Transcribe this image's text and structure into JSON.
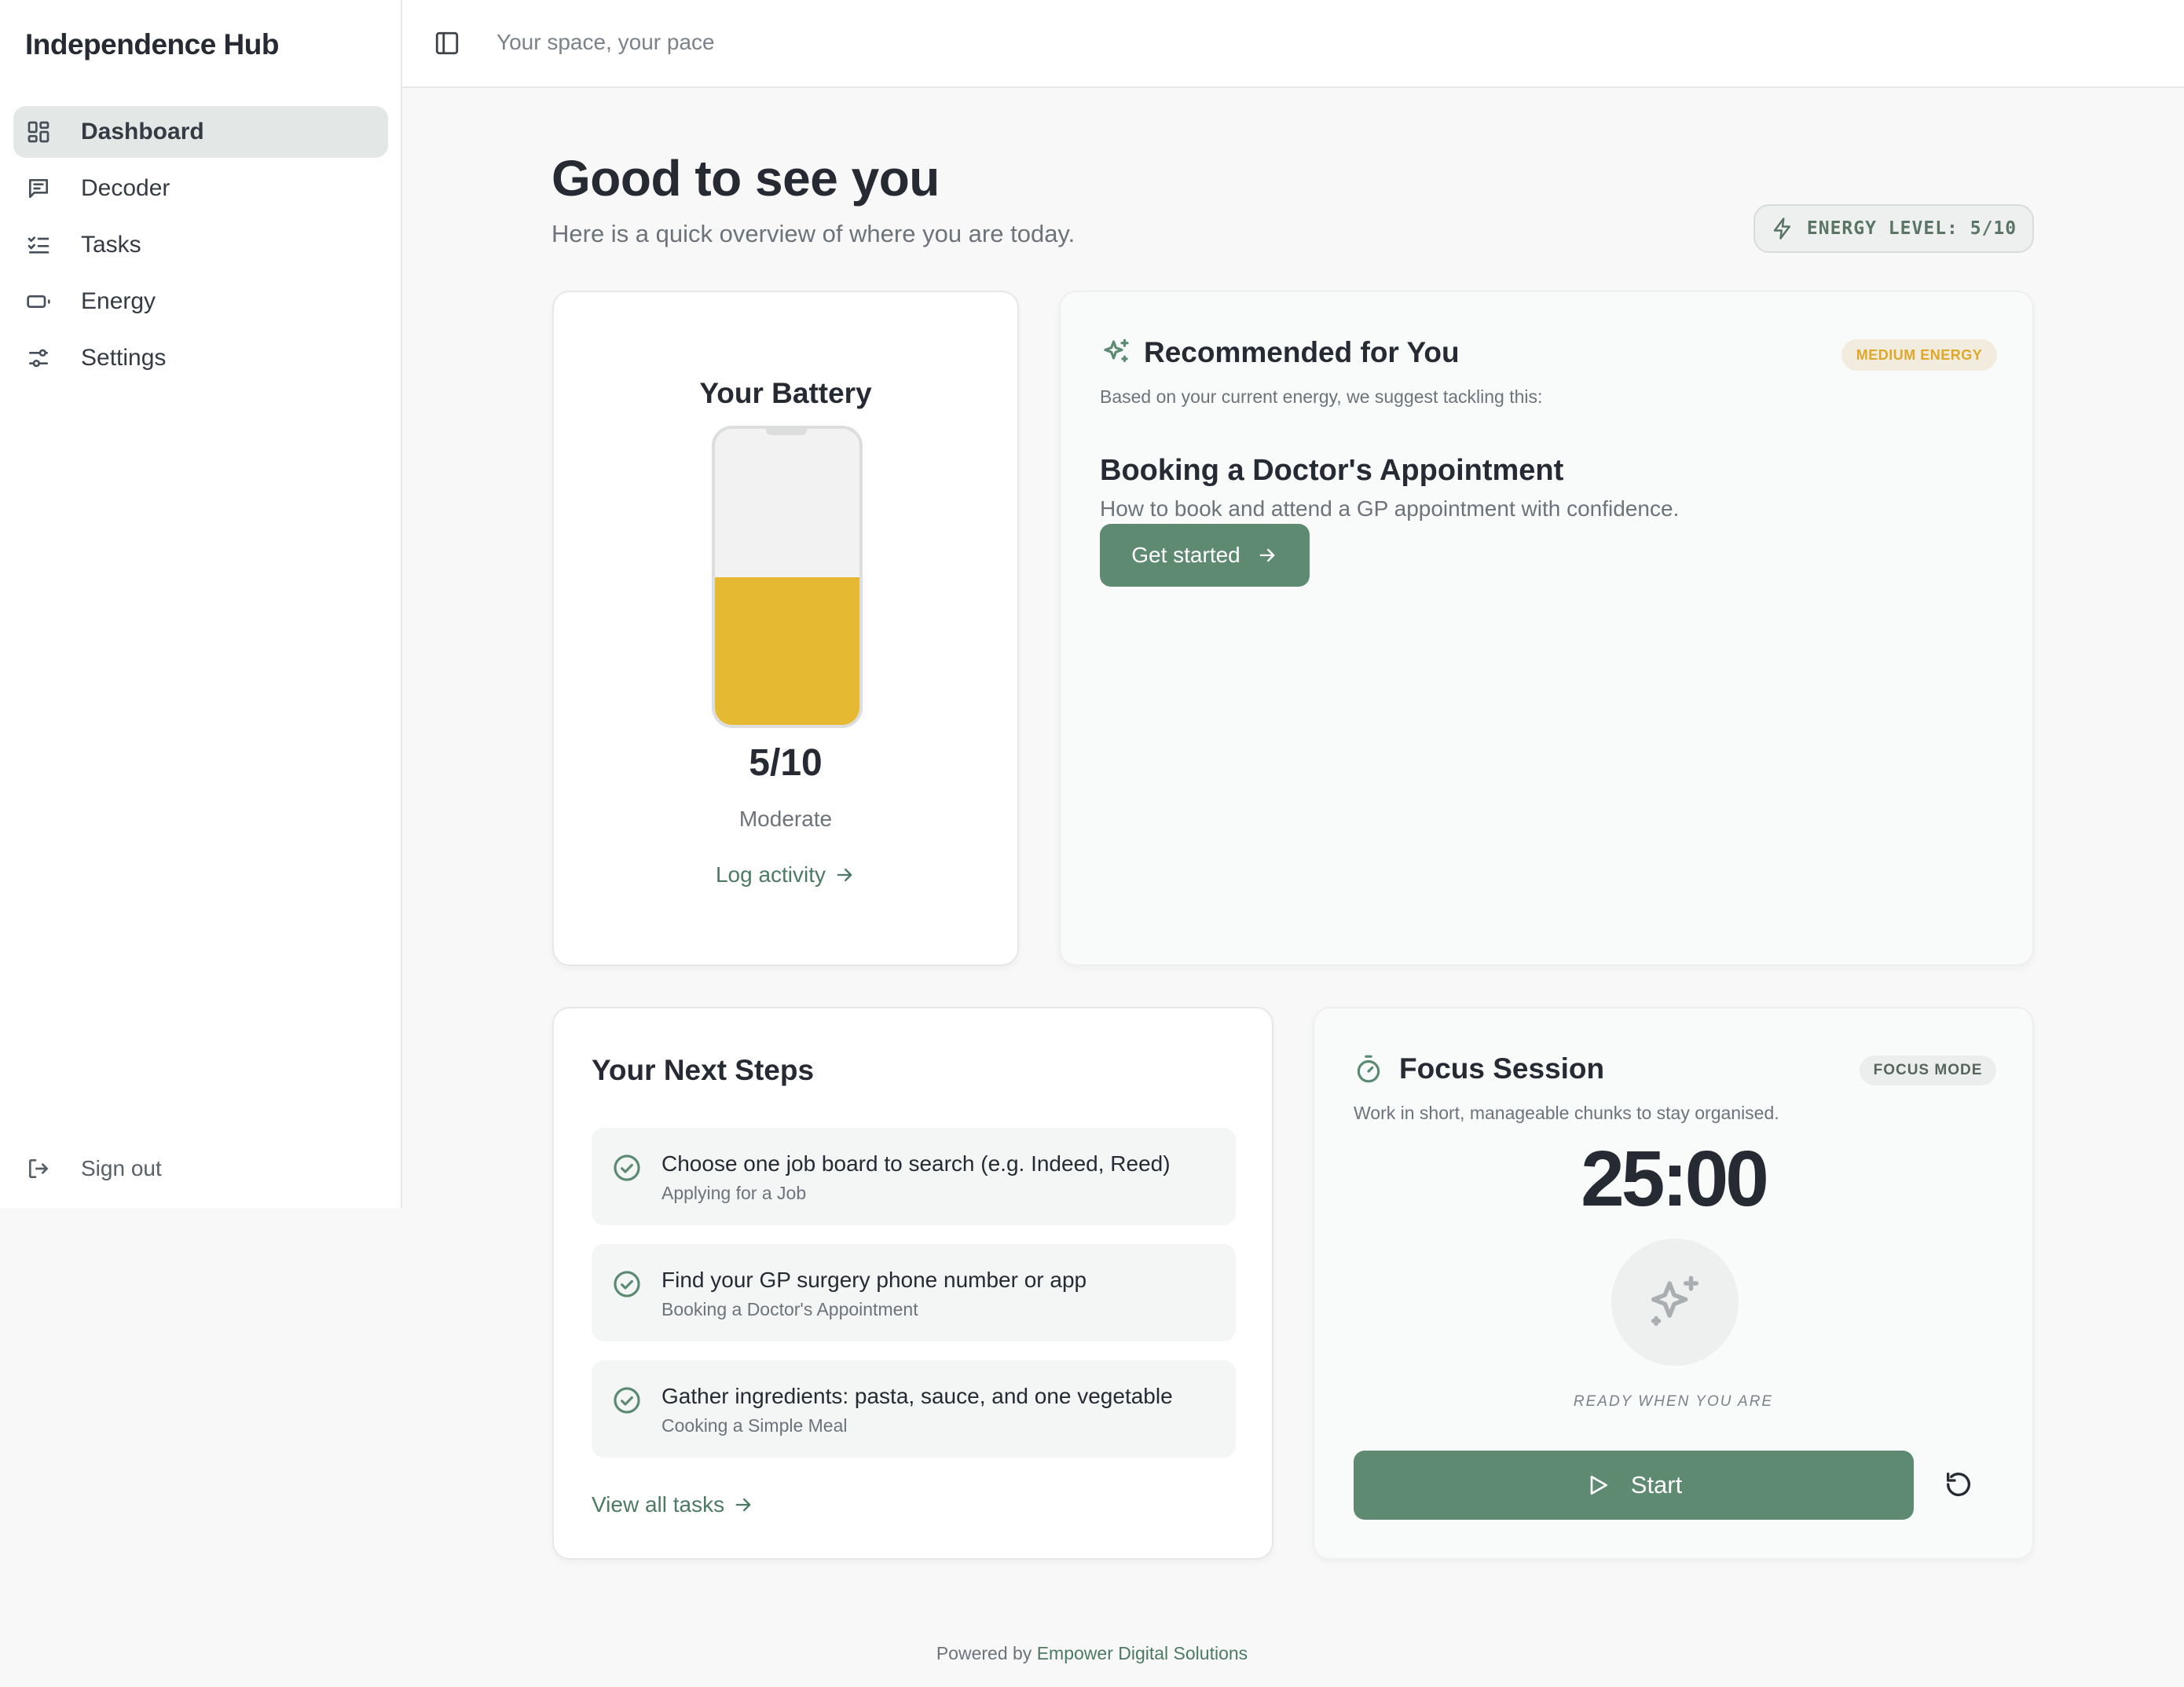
{
  "app": {
    "title": "Independence Hub",
    "tagline": "Your space, your pace"
  },
  "sidebar": {
    "items": [
      {
        "label": "Dashboard",
        "icon": "dashboard-icon",
        "active": true
      },
      {
        "label": "Decoder",
        "icon": "message-icon"
      },
      {
        "label": "Tasks",
        "icon": "list-checks-icon"
      },
      {
        "label": "Energy",
        "icon": "battery-icon"
      },
      {
        "label": "Settings",
        "icon": "sliders-icon"
      }
    ],
    "signout_label": "Sign out"
  },
  "header": {
    "greeting": "Good to see you",
    "subtitle": "Here is a quick overview of where you are today.",
    "energy_pill": "ENERGY LEVEL: 5/10"
  },
  "battery": {
    "title": "Your Battery",
    "value_text": "5/10",
    "level_fraction": 0.5,
    "label": "Moderate",
    "link": "Log activity",
    "fill_color": "#e6b932"
  },
  "recommended": {
    "title": "Recommended for You",
    "badge": "MEDIUM ENERGY",
    "description": "Based on your current energy, we suggest tackling this:",
    "task_title": "Booking a Doctor's Appointment",
    "task_description": "How to book and attend a GP appointment with confidence.",
    "button": "Get started"
  },
  "next_steps": {
    "title": "Your Next Steps",
    "items": [
      {
        "main": "Choose one job board to search (e.g. Indeed, Reed)",
        "sub": "Applying for a Job"
      },
      {
        "main": "Find your GP surgery phone number or app",
        "sub": "Booking a Doctor's Appointment"
      },
      {
        "main": "Gather ingredients: pasta, sauce, and one vegetable",
        "sub": "Cooking a Simple Meal"
      }
    ],
    "link": "View all tasks"
  },
  "focus": {
    "title": "Focus Session",
    "badge": "FOCUS MODE",
    "description": "Work in short, manageable chunks to stay organised.",
    "timer": "25:00",
    "status": "READY WHEN YOU ARE",
    "start_label": "Start"
  },
  "footer": {
    "prefix": "Powered by",
    "brand": "Empower Digital Solutions"
  },
  "colors": {
    "accent": "#5e8a72",
    "energy_yellow": "#e6b932",
    "active_nav": "#e3e7e5"
  }
}
